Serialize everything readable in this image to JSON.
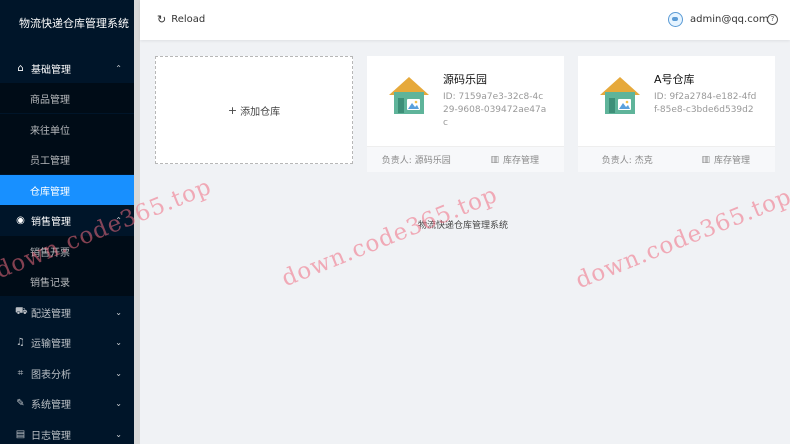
{
  "app": {
    "title": "物流快递仓库管理系统"
  },
  "sidebar": {
    "groups": [
      {
        "label": "基础管理",
        "icon": "home-icon",
        "expanded": true,
        "items": [
          "商品管理",
          "来往单位",
          "员工管理",
          "仓库管理"
        ],
        "active": "仓库管理"
      },
      {
        "label": "销售管理",
        "icon": "sales-icon",
        "expanded": true,
        "items": [
          "销售开票",
          "销售记录"
        ]
      },
      {
        "label": "配送管理",
        "icon": "truck-icon"
      },
      {
        "label": "运输管理",
        "icon": "bell-icon"
      },
      {
        "label": "图表分析",
        "icon": "line-chart-icon"
      },
      {
        "label": "系统管理",
        "icon": "tool-icon"
      },
      {
        "label": "日志管理",
        "icon": "file-icon"
      }
    ]
  },
  "header": {
    "reload_label": "Reload",
    "user_email": "admin@qq.com"
  },
  "add_card": {
    "label": "添加仓库"
  },
  "warehouses": [
    {
      "name": "源码乐园",
      "id_text": "ID: 7159a7e3-32c8-4c29-9608-039472ae47ac",
      "manager_text": "负责人: 源码乐园",
      "inventory_label": "库存管理"
    },
    {
      "name": "A号仓库",
      "id_text": "ID: 9f2a2784-e182-4fdf-85e8-c3bde6d539d2",
      "manager_text": "负责人: 杰克",
      "inventory_label": "库存管理"
    }
  ],
  "footer_text": "物流快递仓库管理系统",
  "watermark": "down.code365.top",
  "colors": {
    "sidebar_bg": "#001529",
    "submenu_bg": "#000c17",
    "active": "#1890ff"
  }
}
